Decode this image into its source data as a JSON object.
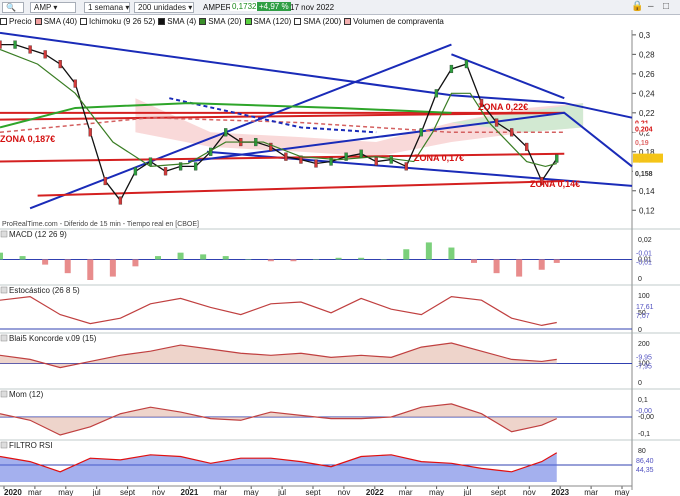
{
  "toolbar": {
    "ticker": "AMP",
    "period": "1 semana",
    "units": "200 unidades",
    "name": "AMPER",
    "price": "0,1732",
    "change": "+4,97 %",
    "date": "17 nov 2022"
  },
  "legend": [
    {
      "label": "Precio",
      "color": "#ffffff"
    },
    {
      "label": "SMA (40)",
      "color": "#f2a0a0"
    },
    {
      "label": "Ichimoku (9 26 52)",
      "color": "#ffffff"
    },
    {
      "label": "SMA (4)",
      "color": "#111111"
    },
    {
      "label": "SMA (20)",
      "color": "#3a8f2a"
    },
    {
      "label": "SMA (120)",
      "color": "#5ad040"
    },
    {
      "label": "SMA (200)",
      "color": "#ffffff"
    },
    {
      "label": "Volumen de compraventa",
      "color": "#f4b0b0"
    }
  ],
  "chart_data": [
    {
      "type": "line",
      "title": "Precio",
      "y_ticks": [
        "0,3",
        "0,28",
        "0,26",
        "0,24",
        "0,22",
        "0,2",
        "0,18",
        "0,16",
        "0,14",
        "0,12"
      ],
      "ylim": [
        0.11,
        0.305
      ],
      "x_labels": [
        "2020",
        "mar",
        "may",
        "jul",
        "sept",
        "nov",
        "2021",
        "mar",
        "may",
        "jul",
        "sept",
        "nov",
        "2022",
        "mar",
        "may",
        "jul",
        "sept",
        "nov",
        "2023",
        "mar",
        "may"
      ],
      "series": [
        {
          "name": "Precio",
          "x": [
            0,
            4,
            8,
            12,
            16,
            20,
            24,
            28,
            32,
            36,
            40,
            44,
            48,
            52,
            56,
            60,
            64,
            68,
            72,
            76,
            80,
            84,
            88,
            92,
            96,
            100,
            104,
            108,
            112,
            116,
            120,
            124,
            128,
            132,
            136,
            140,
            144,
            148
          ],
          "values": [
            0.29,
            0.29,
            0.285,
            0.28,
            0.27,
            0.25,
            0.2,
            0.15,
            0.13,
            0.16,
            0.17,
            0.16,
            0.165,
            0.165,
            0.18,
            0.2,
            0.19,
            0.19,
            0.185,
            0.175,
            0.172,
            0.168,
            0.17,
            0.175,
            0.178,
            0.17,
            0.172,
            0.165,
            0.2,
            0.24,
            0.265,
            0.27,
            0.23,
            0.21,
            0.2,
            0.185,
            0.15,
            0.173
          ]
        },
        {
          "name": "SMA (20)",
          "x": [
            0,
            10,
            20,
            30,
            40,
            50,
            60,
            70,
            80,
            90,
            100,
            110,
            115,
            120,
            125,
            130,
            135,
            140,
            145,
            148
          ],
          "values": [
            0.285,
            0.27,
            0.24,
            0.19,
            0.165,
            0.168,
            0.19,
            0.19,
            0.175,
            0.172,
            0.175,
            0.17,
            0.2,
            0.24,
            0.24,
            0.21,
            0.19,
            0.17,
            0.165,
            0.168
          ]
        }
      ],
      "annotations": [
        "ZONA 0,22€",
        "ZONA 0,17€",
        "ZONA 0,14€",
        "ZONA 0,187€"
      ],
      "right_labels": [
        "0,21",
        "0,204",
        "0,19",
        "0,173",
        "0,158"
      ],
      "watermark": "ProRealTime.com - Diferido de 15 min - Tiempo real en [CBOE]"
    },
    {
      "type": "bar",
      "title": "MACD (12 26 9)",
      "y_ticks": [
        "0,02",
        "0,01",
        "0"
      ],
      "right_labels": [
        "-0,01",
        "-0,01"
      ],
      "x": [
        0,
        6,
        12,
        18,
        24,
        30,
        36,
        42,
        48,
        54,
        60,
        66,
        72,
        78,
        84,
        90,
        96,
        102,
        108,
        114,
        120,
        126,
        132,
        138,
        144,
        148
      ],
      "values": [
        0.004,
        0.002,
        -0.003,
        -0.008,
        -0.012,
        -0.01,
        -0.004,
        0.002,
        0.004,
        0.003,
        0.002,
        0,
        -0.001,
        -0.001,
        0,
        0.001,
        0.001,
        0,
        0.006,
        0.01,
        0.007,
        -0.002,
        -0.008,
        -0.01,
        -0.006,
        -0.002
      ]
    },
    {
      "type": "line",
      "title": "Estocástico (26 8 5)",
      "y_ticks": [
        "100",
        "50",
        "0"
      ],
      "right_labels": [
        "17,61",
        "7,07"
      ],
      "x": [
        0,
        8,
        16,
        24,
        32,
        40,
        48,
        56,
        64,
        72,
        80,
        88,
        96,
        104,
        112,
        120,
        128,
        136,
        144,
        148
      ],
      "values": [
        80,
        90,
        40,
        15,
        30,
        70,
        85,
        60,
        40,
        70,
        75,
        45,
        85,
        55,
        40,
        90,
        80,
        30,
        10,
        18
      ]
    },
    {
      "type": "area",
      "title": "Blai5 Koncorde v.09 (15)",
      "y_ticks": [
        "200",
        "100",
        "0"
      ],
      "right_labels": [
        "-9,95",
        "-7,95"
      ],
      "x": [
        0,
        8,
        16,
        24,
        32,
        40,
        48,
        56,
        64,
        72,
        80,
        88,
        96,
        104,
        112,
        120,
        128,
        136,
        144,
        148
      ],
      "values": [
        40,
        20,
        -20,
        10,
        40,
        60,
        90,
        70,
        50,
        40,
        50,
        30,
        40,
        30,
        80,
        100,
        60,
        20,
        10,
        20
      ]
    },
    {
      "type": "area",
      "title": "Mom (12)",
      "y_ticks": [
        "0,1",
        "-0,00",
        "-0,1"
      ],
      "right_labels": [
        "-0,00"
      ],
      "x": [
        0,
        8,
        16,
        24,
        32,
        40,
        48,
        56,
        64,
        72,
        80,
        88,
        96,
        104,
        112,
        120,
        128,
        136,
        144,
        148
      ],
      "values": [
        0.02,
        -0.02,
        -0.11,
        -0.06,
        0.02,
        0.06,
        0.03,
        -0.01,
        -0.02,
        0.03,
        0.01,
        -0.01,
        -0.01,
        0,
        0.06,
        0.08,
        0.02,
        -0.09,
        -0.05,
        -0.01
      ]
    },
    {
      "type": "area",
      "title": "FILTRO RSI",
      "y_ticks": [
        "80"
      ],
      "right_labels": [
        "86,40",
        "44,35"
      ],
      "x": [
        0,
        8,
        16,
        24,
        32,
        40,
        48,
        56,
        64,
        72,
        80,
        88,
        96,
        104,
        112,
        120,
        128,
        136,
        144,
        148
      ],
      "values": [
        75,
        60,
        30,
        70,
        65,
        80,
        75,
        55,
        70,
        70,
        60,
        45,
        75,
        80,
        60,
        55,
        40,
        30,
        60,
        86
      ]
    }
  ]
}
